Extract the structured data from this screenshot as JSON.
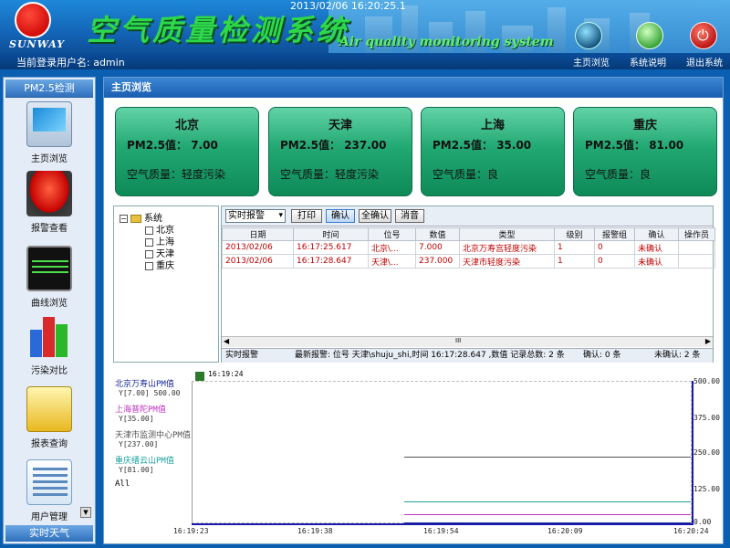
{
  "header": {
    "datetime": "2013/02/06    16:20:25.1",
    "logo_text": "SUNWAY",
    "title_cn": "空气质量检测系统",
    "title_en": "Air quality monitoring system"
  },
  "navbar": {
    "user_label": "当前登录用户名: admin",
    "links": [
      "主页浏览",
      "系统说明",
      "退出系统"
    ]
  },
  "sidebar": {
    "head": "PM2.5检测",
    "items": [
      "主页浏览",
      "报警查看",
      "曲线浏览",
      "污染对比",
      "报表查询",
      "用户管理"
    ],
    "foot": "实时天气"
  },
  "main": {
    "title": "主页浏览",
    "cities": [
      {
        "name": "北京",
        "pm_label": "PM2.5值：",
        "pm_value": "7.00",
        "aq": "空气质量：轻度污染"
      },
      {
        "name": "天津",
        "pm_label": "PM2.5值：",
        "pm_value": "237.00",
        "aq": "空气质量：轻度污染"
      },
      {
        "name": "上海",
        "pm_label": "PM2.5值：",
        "pm_value": "35.00",
        "aq": "空气质量：良"
      },
      {
        "name": "重庆",
        "pm_label": "PM2.5值：",
        "pm_value": "81.00",
        "aq": "空气质量：良"
      }
    ]
  },
  "tree": {
    "root": "系统",
    "children": [
      "北京",
      "上海",
      "天津",
      "重庆"
    ]
  },
  "alarm": {
    "select_value": "实时报警",
    "buttons": [
      "打印",
      "确认",
      "全确认",
      "消音"
    ],
    "columns": [
      "日期",
      "时间",
      "位号",
      "数值",
      "类型",
      "级别",
      "报警组",
      "确认",
      "操作员"
    ],
    "rows": [
      [
        "2013/02/06",
        "16:17:25.617",
        "北京\\...",
        "7.000",
        "北京万寿宫轻度污染",
        "1",
        "0",
        "未确认",
        ""
      ],
      [
        "2013/02/06",
        "16:17:28.647",
        "天津\\...",
        "237.000",
        "天津市轻度污染",
        "1",
        "0",
        "未确认",
        ""
      ]
    ],
    "scroll_marker": "III",
    "status": {
      "label": "实时报警",
      "latest": "最新报警: 位号 天津\\shuju_shi,时间 16:17:28.647 ,数值 记录总数: 2 条",
      "confirmed": "确认: 0 条",
      "unconfirmed": "未确认: 2 条"
    }
  },
  "trend": {
    "cursor_time": "16:19:24",
    "series": [
      {
        "name": "北京万寿山PM值",
        "value": "Y[7.00]",
        "extra": "500.00",
        "color": "#1a2a9a"
      },
      {
        "name": "上海普陀PM值",
        "value": "Y[35.00]",
        "color": "#c030c0"
      },
      {
        "name": "天津市监测中心PM值",
        "value": "Y[237.00]",
        "color": "#555555"
      },
      {
        "name": "重庆缙云山PM值",
        "value": "Y[81.00]",
        "color": "#20a0a0"
      }
    ],
    "all_label": "All",
    "y_ticks": [
      "500.00",
      "375.00",
      "250.00",
      "125.00",
      "0.00"
    ],
    "x_ticks": [
      "16:19:23",
      "16:19:38",
      "16:19:54",
      "16:20:09",
      "16:20:24"
    ]
  }
}
